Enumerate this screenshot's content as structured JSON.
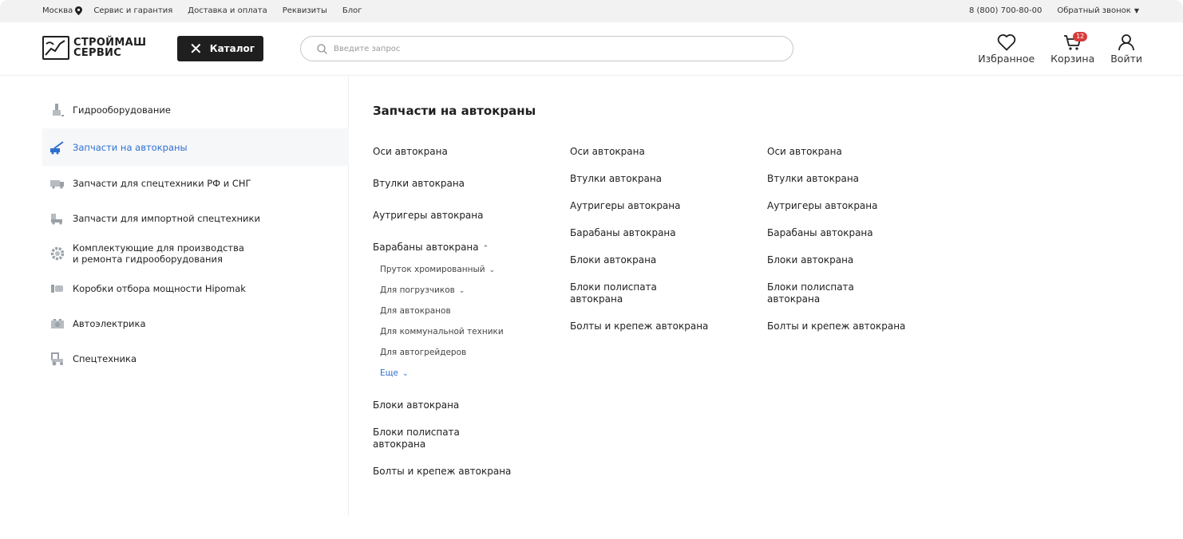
{
  "topbar": {
    "city": "Москва",
    "links": [
      "Сервис и гарантия",
      "Доставка и оплата",
      "Реквизиты",
      "Блог"
    ],
    "phone": "8 (800) 700-80-00",
    "callback": "Обратный звонок"
  },
  "header": {
    "logo_line1": "СТРОЙМАШ",
    "logo_line2": "СЕРВИС",
    "catalog_label": "Каталог",
    "search_placeholder": "Введите запрос",
    "favorites_label": "Избранное",
    "cart_label": "Корзина",
    "cart_count": "12",
    "login_label": "Войти"
  },
  "sidebar": {
    "items": [
      {
        "label": "Гидрооборудование",
        "icon": "hydraulic-icon"
      },
      {
        "label": "Запчасти на автокраны",
        "icon": "crane-icon",
        "active": true
      },
      {
        "label": "Запчасти для спецтехники РФ и СНГ",
        "icon": "truck-icon"
      },
      {
        "label": "Запчасти для импортной спецтехники",
        "icon": "loader-icon"
      },
      {
        "label": "Комплектующие для производства",
        "label2": "и ремонта гидрооборудования",
        "icon": "gear-icon"
      },
      {
        "label": "Коробки отбора мощности Hipomak",
        "icon": "gearbox-icon"
      },
      {
        "label": "Автоэлектрика",
        "icon": "battery-icon"
      },
      {
        "label": "Спецтехника",
        "icon": "tractor-icon"
      }
    ]
  },
  "main": {
    "title": "Запчасти на автокраны",
    "col1": {
      "axles": "Оси автокрана",
      "bushings": "Втулки автокрана",
      "outriggers": "Аутригеры автокрана",
      "drums": "Барабаны автокрана",
      "sub": [
        "Пруток хромированный",
        "Для погрузчиков",
        "Для автокранов",
        "Для коммунальной техники",
        "Для автогрейдеров"
      ],
      "more": "Еще",
      "blocks": "Блоки автокрана",
      "polyspast_1": "Блоки полиспата",
      "polyspast_2": "автокрана",
      "bolts": "Болты и крепеж автокрана"
    },
    "col2": [
      "Оси автокрана",
      "Втулки автокрана",
      "Аутригеры автокрана",
      "Барабаны автокрана",
      "Блоки автокрана",
      "Блоки полиспата",
      "автокрана",
      "Болты и крепеж автокрана"
    ],
    "col3": [
      "Оси автокрана",
      "Втулки автокрана",
      "Аутригеры автокрана",
      "Барабаны автокрана",
      "Блоки автокрана",
      "Блоки полиспата",
      "автокрана",
      "Болты и крепеж автокрана"
    ]
  }
}
